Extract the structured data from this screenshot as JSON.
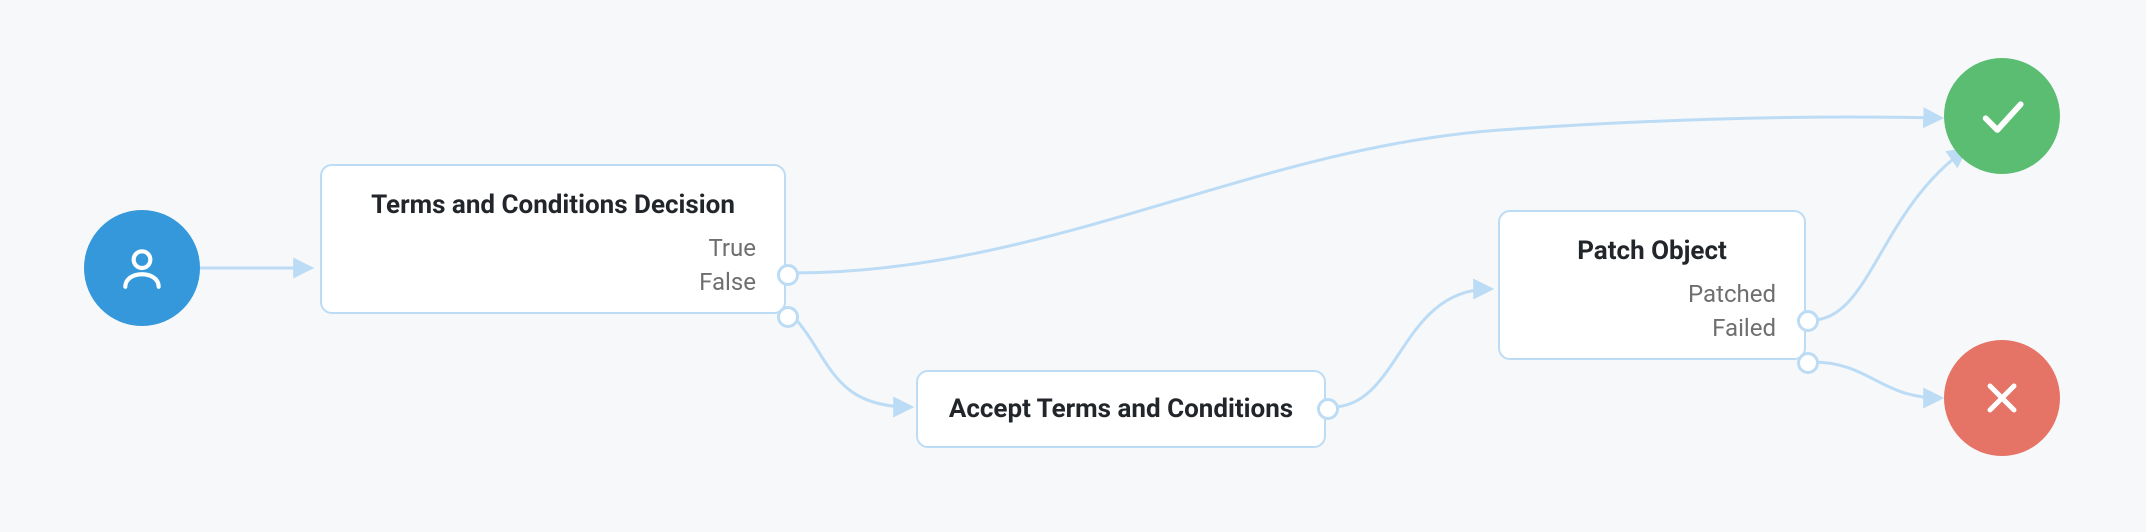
{
  "nodes": {
    "start": {
      "icon": "user-icon"
    },
    "decision": {
      "title": "Terms and Conditions Decision",
      "outputs": [
        "True",
        "False"
      ]
    },
    "accept": {
      "title": "Accept Terms and Conditions"
    },
    "patch": {
      "title": "Patch Object",
      "outputs": [
        "Patched",
        "Failed"
      ]
    },
    "success": {
      "icon": "check-icon"
    },
    "fail": {
      "icon": "close-icon"
    }
  },
  "colors": {
    "start": "#3498db",
    "success": "#5bbd72",
    "fail": "#e57366",
    "edge": "#bcdcf5",
    "node_border": "#bcdcf5",
    "node_bg": "#ffffff",
    "title": "#22262b",
    "output_label": "#6f6f6f",
    "bg": "#f7f8fa"
  }
}
